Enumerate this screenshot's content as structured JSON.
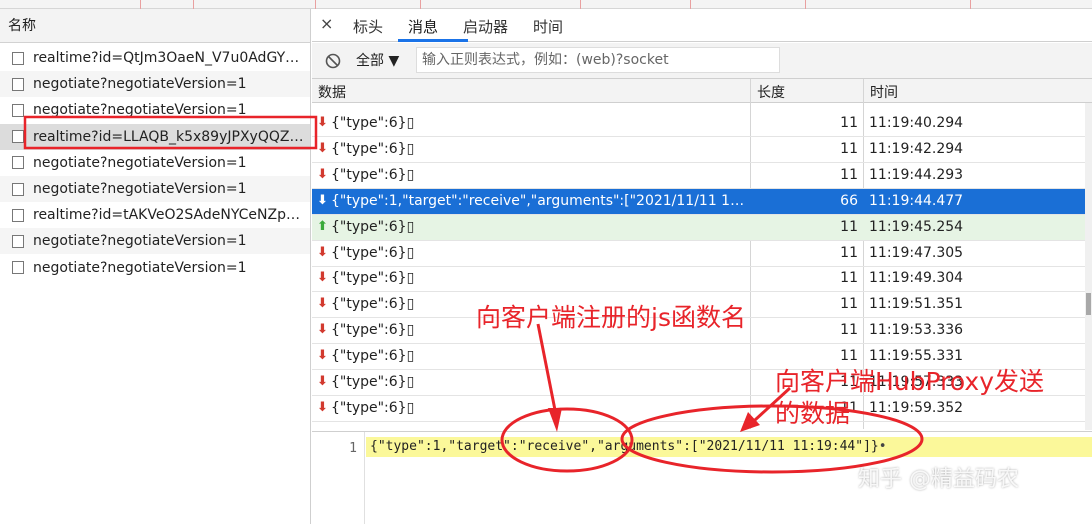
{
  "left_panel": {
    "header": "名称",
    "requests": [
      {
        "name": "realtime?id=QtJm3OaeN_V7u0AdGYco..."
      },
      {
        "name": "negotiate?negotiateVersion=1"
      },
      {
        "name": "negotiate?negotiateVersion=1"
      },
      {
        "name": "realtime?id=LLAQB_k5x89yJPXyQQZcN..."
      },
      {
        "name": "negotiate?negotiateVersion=1"
      },
      {
        "name": "negotiate?negotiateVersion=1"
      },
      {
        "name": "realtime?id=tAKVeO2SAdeNYCeNZpQ..."
      },
      {
        "name": "negotiate?negotiateVersion=1"
      },
      {
        "name": "negotiate?negotiateVersion=1"
      }
    ],
    "selected_index": 3
  },
  "tabs": {
    "close": "×",
    "items": [
      "标头",
      "消息",
      "启动器",
      "时间"
    ],
    "active": "消息"
  },
  "filter": {
    "select_label": "全部 ▼",
    "placeholder": "输入正则表达式，例如：(web)?socket"
  },
  "table": {
    "headers": {
      "data": "数据",
      "length": "长度",
      "time": "时间"
    },
    "rows": [
      {
        "dir": "down",
        "data": "{\"type\":6}▯",
        "length": "11",
        "time": "11:19:40.294"
      },
      {
        "dir": "down",
        "data": "{\"type\":6}▯",
        "length": "11",
        "time": "11:19:42.294"
      },
      {
        "dir": "down",
        "data": "{\"type\":6}▯",
        "length": "11",
        "time": "11:19:44.293"
      },
      {
        "dir": "down",
        "data": "{\"type\":1,\"target\":\"receive\",\"arguments\":[\"2021/11/11 11:19:4...",
        "length": "66",
        "time": "11:19:44.477",
        "selected": true
      },
      {
        "dir": "up",
        "data": "{\"type\":6}▯",
        "length": "11",
        "time": "11:19:45.254"
      },
      {
        "dir": "down",
        "data": "{\"type\":6}▯",
        "length": "11",
        "time": "11:19:47.305"
      },
      {
        "dir": "down",
        "data": "{\"type\":6}▯",
        "length": "11",
        "time": "11:19:49.304"
      },
      {
        "dir": "down",
        "data": "{\"type\":6}▯",
        "length": "11",
        "time": "11:19:51.351"
      },
      {
        "dir": "down",
        "data": "{\"type\":6}▯",
        "length": "11",
        "time": "11:19:53.336"
      },
      {
        "dir": "down",
        "data": "{\"type\":6}▯",
        "length": "11",
        "time": "11:19:55.331"
      },
      {
        "dir": "down",
        "data": "{\"type\":6}▯",
        "length": "11",
        "time": "11:19:57.333"
      },
      {
        "dir": "down",
        "data": "{\"type\":6}▯",
        "length": "11",
        "time": "11:19:59.352"
      }
    ]
  },
  "detail": {
    "line_number": "1",
    "code": "{\"type\":1,\"target\":\"receive\",\"arguments\":[\"2021/11/11 11:19:44\"]}",
    "caret": "•"
  },
  "annotations": {
    "label_1": "向客户端注册的js函数名",
    "label_2_line1": "向客户端HubProxy发送",
    "label_2_line2": "的数据",
    "color": "#e8242a"
  },
  "watermark": "知乎 @精益码农",
  "colors": {
    "selected_row": "#1a6fd6",
    "sent_row": "#e6f4e4",
    "code_highlight": "#fbf89a",
    "tab_accent": "#1a73e8"
  }
}
